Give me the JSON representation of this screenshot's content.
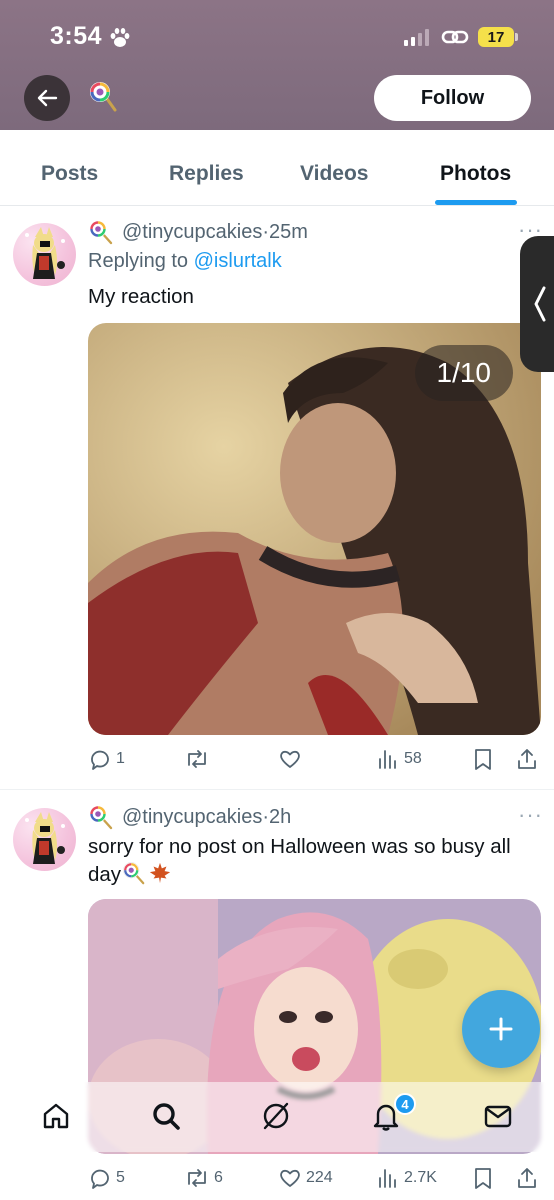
{
  "status_bar": {
    "time": "3:54",
    "battery": "17"
  },
  "header": {
    "follow_label": "Follow",
    "back_icon": "arrow-left-icon",
    "profile_emoji_icon": "lollipop-icon"
  },
  "tabs": [
    {
      "label": "Posts",
      "active": false
    },
    {
      "label": "Replies",
      "active": false
    },
    {
      "label": "Videos",
      "active": false
    },
    {
      "label": "Photos",
      "active": true
    }
  ],
  "posts": [
    {
      "handle": "@tinycupcakies",
      "separator": "·",
      "time": "25m",
      "reply_prefix": "Replying to",
      "reply_to": "@islurtalk",
      "text": "My reaction",
      "media_counter": "1/10",
      "actions": {
        "replies": "1",
        "reposts": "",
        "likes": "",
        "views": "58"
      }
    },
    {
      "handle": "@tinycupcakies",
      "separator": "·",
      "time": "2h",
      "text": "sorry for no post on Halloween was so busy all day",
      "actions": {
        "replies": "5",
        "reposts": "6",
        "likes": "224",
        "views": "2.7K"
      }
    }
  ],
  "bottom_nav": {
    "items": [
      "home-icon",
      "search-icon",
      "grok-icon",
      "notifications-icon",
      "messages-icon"
    ],
    "notification_count": "4"
  },
  "colors": {
    "accent": "#1d9bf0",
    "header_bg": "#8c7486",
    "text_primary": "#0f1419",
    "text_secondary": "#536471"
  }
}
